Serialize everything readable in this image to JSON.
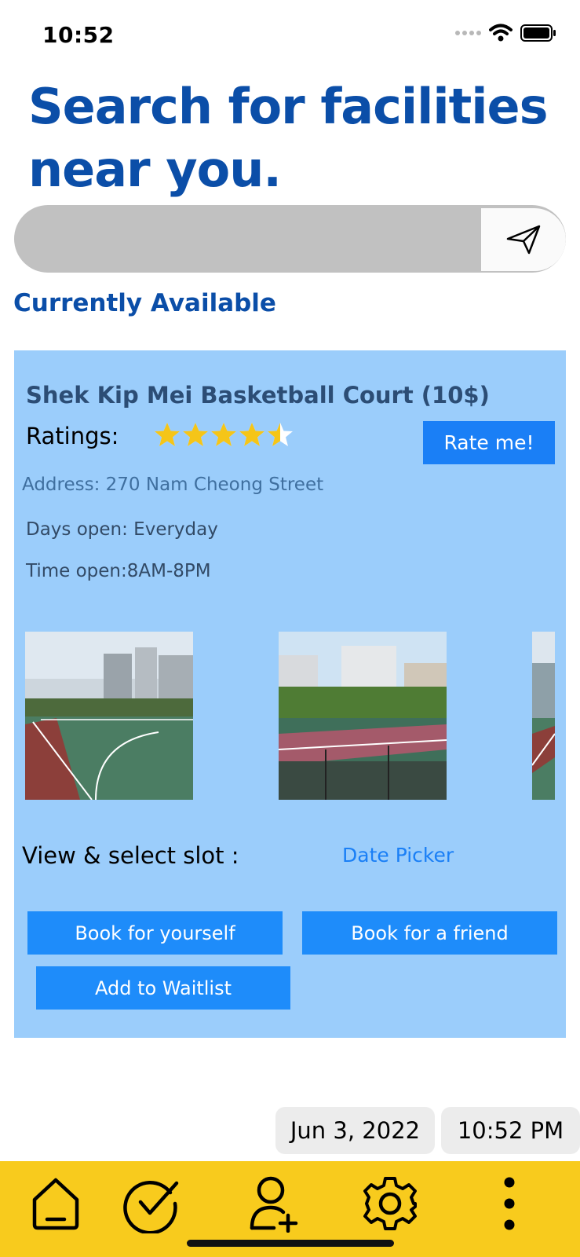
{
  "status_bar": {
    "time": "10:52"
  },
  "header": {
    "title": "Search for facilities near you."
  },
  "search": {
    "placeholder": ""
  },
  "section": {
    "title": "Currently Available"
  },
  "facility": {
    "name": "Shek Kip Mei Basketball Court (10$)",
    "ratings_label": "Ratings:",
    "rating": 4.5,
    "rating_max": 5,
    "rate_button": "Rate me!",
    "address": "Address: 270 Nam Cheong Street",
    "days_open": "Days open: Everyday",
    "time_open": "Time open:8AM-8PM",
    "slot_label": "View & select slot :",
    "date_picker": "Date Picker",
    "book_self": "Book for yourself",
    "book_friend": "Book for a friend",
    "waitlist": "Add to Waitlist"
  },
  "datetime": {
    "date": "Jun 3, 2022",
    "time": "10:52 PM"
  },
  "tabs": [
    {
      "icon": "home-icon"
    },
    {
      "icon": "checkmark-icon"
    },
    {
      "icon": "add-person-icon"
    },
    {
      "icon": "gear-icon"
    },
    {
      "icon": "more-icon"
    }
  ],
  "colors": {
    "title_blue": "#0b4ea8",
    "card_background": "#9bcdfb",
    "button_blue": "#1e8cfa",
    "tab_bar_yellow": "#f8cb1d",
    "star_gold": "#f5c518"
  }
}
